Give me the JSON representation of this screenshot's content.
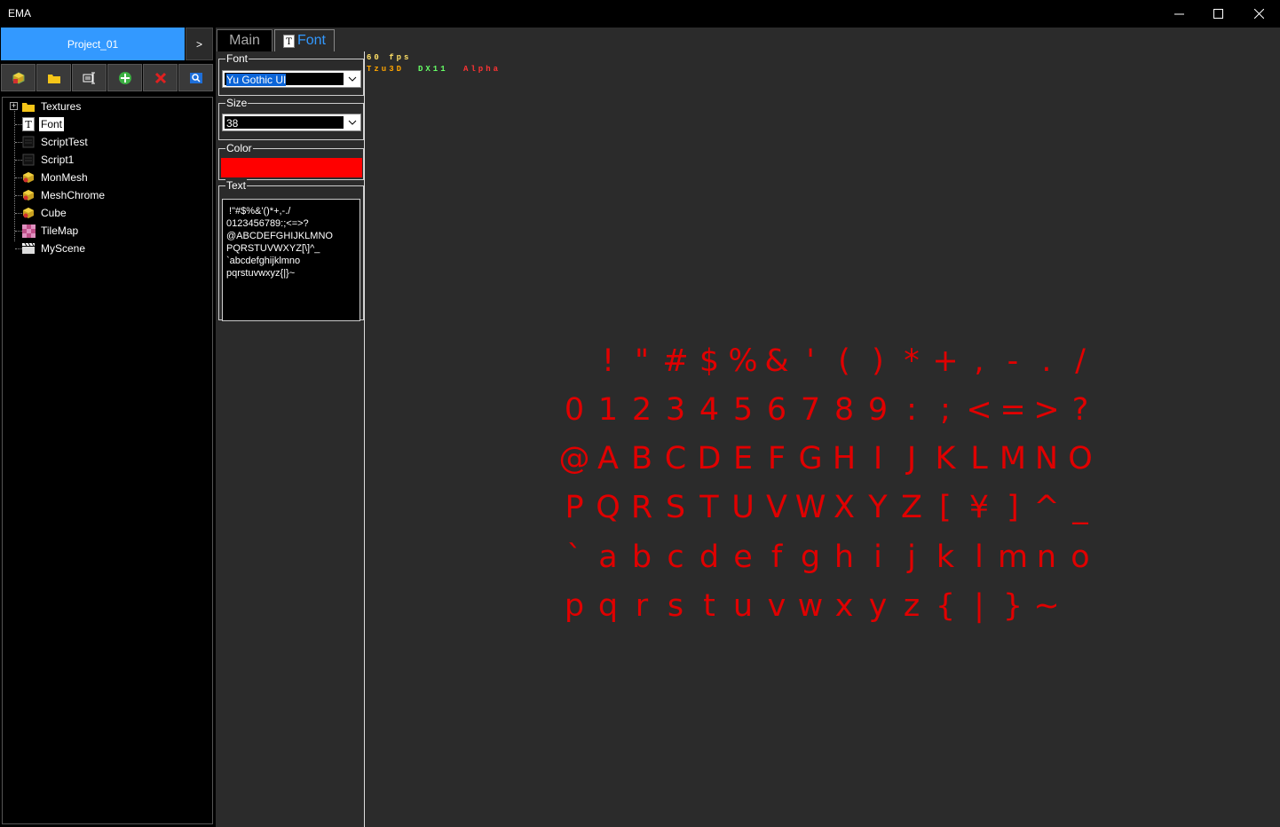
{
  "window": {
    "title": "EMA"
  },
  "project": {
    "name": "Project_01",
    "expand_label": ">"
  },
  "toolbar": {
    "icons": [
      "box-icon",
      "folder-icon",
      "text-tool-icon",
      "add-icon",
      "delete-icon",
      "search-icon"
    ]
  },
  "tree": {
    "items": [
      {
        "label": "Textures",
        "icon": "folder-icon"
      },
      {
        "label": "Font",
        "icon": "font-icon"
      },
      {
        "label": "ScriptTest",
        "icon": "script-icon"
      },
      {
        "label": "Script1",
        "icon": "script-icon"
      },
      {
        "label": "MonMesh",
        "icon": "mesh-icon"
      },
      {
        "label": "MeshChrome",
        "icon": "mesh-icon"
      },
      {
        "label": "Cube",
        "icon": "mesh-icon"
      },
      {
        "label": "TileMap",
        "icon": "tilemap-icon"
      },
      {
        "label": "MyScene",
        "icon": "scene-icon"
      }
    ],
    "selected": "Font"
  },
  "tabs": {
    "main": "Main",
    "font": "Font"
  },
  "props": {
    "font_legend": "Font",
    "font_value": "Yu Gothic UI",
    "size_legend": "Size",
    "size_value": "38",
    "color_legend": "Color",
    "color_value": "#ff0000",
    "text_legend": "Text",
    "text_lines": [
      " !\"#$%&'()*+,-./",
      "0123456789:;<=>?",
      "@ABCDEFGHIJKLMNO",
      "PQRSTUVWXYZ[\\]^_",
      "`abcdefghijklmno",
      "pqrstuvwxyz{|}~"
    ]
  },
  "viewport": {
    "fps": "60 fps",
    "engine": "Tzu3D",
    "api": "DX11",
    "mode": "Alpha",
    "preview_rows": [
      [
        " ",
        "!",
        "\"",
        "#",
        "$",
        "%",
        "&",
        "'",
        "(",
        ")",
        "*",
        "+",
        ",",
        "-",
        ".",
        "/"
      ],
      [
        "0",
        "1",
        "2",
        "3",
        "4",
        "5",
        "6",
        "7",
        "8",
        "9",
        ":",
        ";",
        "<",
        "=",
        ">",
        "?"
      ],
      [
        "@",
        "A",
        "B",
        "C",
        "D",
        "E",
        "F",
        "G",
        "H",
        "I",
        "J",
        "K",
        "L",
        "M",
        "N",
        "O"
      ],
      [
        "P",
        "Q",
        "R",
        "S",
        "T",
        "U",
        "V",
        "W",
        "X",
        "Y",
        "Z",
        "[",
        "¥",
        "]",
        "^",
        "_"
      ],
      [
        "`",
        "a",
        "b",
        "c",
        "d",
        "e",
        "f",
        "g",
        "h",
        "i",
        "j",
        "k",
        "l",
        "m",
        "n",
        "o"
      ],
      [
        "p",
        "q",
        "r",
        "s",
        "t",
        "u",
        "v",
        "w",
        "x",
        "y",
        "z",
        "{",
        "|",
        "}",
        "~",
        " "
      ]
    ],
    "glyph_color": "#e00000"
  },
  "colors": {
    "accent": "#3399ff",
    "panel": "#2b2b2b",
    "fps_color": "#ffe066",
    "engine_color": "#ffa500",
    "api_color": "#66ff66",
    "mode_color": "#ff3333"
  }
}
